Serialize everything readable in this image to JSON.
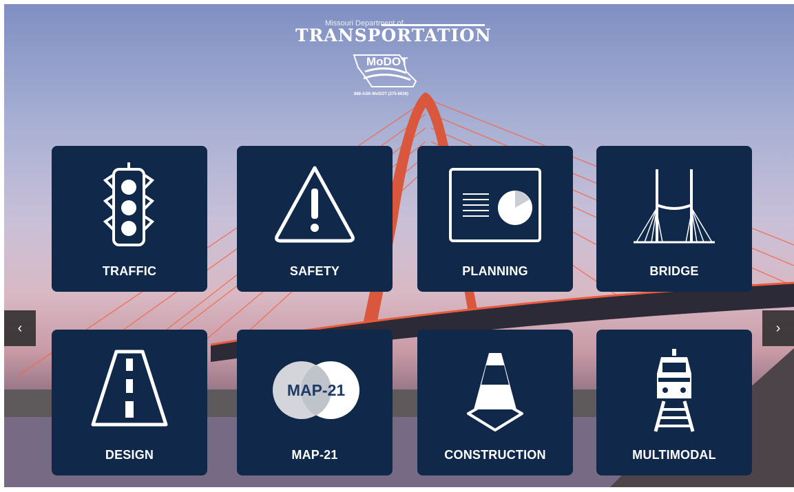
{
  "logo": {
    "department": "Missouri Department of",
    "title": "TRANSPORTATION",
    "modot": "MoDOT",
    "phone": "888-ASK-MoDOT (275-6636)"
  },
  "tiles": [
    {
      "label": "TRAFFIC",
      "icon": "traffic-light-icon"
    },
    {
      "label": "SAFETY",
      "icon": "warning-icon"
    },
    {
      "label": "PLANNING",
      "icon": "presentation-chart-icon"
    },
    {
      "label": "BRIDGE",
      "icon": "bridge-icon"
    },
    {
      "label": "DESIGN",
      "icon": "road-icon"
    },
    {
      "label": "MAP-21",
      "icon": "map21-icon",
      "badge": "MAP-21"
    },
    {
      "label": "CONSTRUCTION",
      "icon": "traffic-cone-icon"
    },
    {
      "label": "MULTIMODAL",
      "icon": "train-icon"
    }
  ],
  "nav": {
    "prev": "‹",
    "next": "›"
  },
  "colors": {
    "tile": "#10284a",
    "accent": "#ffffff"
  }
}
